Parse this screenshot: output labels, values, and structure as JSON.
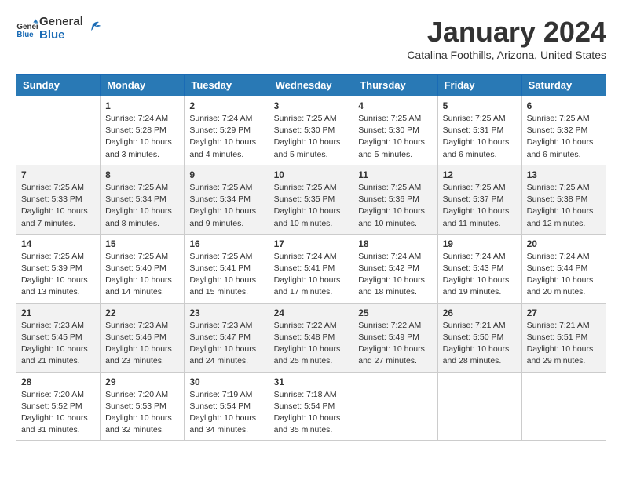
{
  "header": {
    "logo_line1": "General",
    "logo_line2": "Blue",
    "month_title": "January 2024",
    "location": "Catalina Foothills, Arizona, United States"
  },
  "days_of_week": [
    "Sunday",
    "Monday",
    "Tuesday",
    "Wednesday",
    "Thursday",
    "Friday",
    "Saturday"
  ],
  "weeks": [
    [
      {
        "day": "",
        "info": ""
      },
      {
        "day": "1",
        "info": "Sunrise: 7:24 AM\nSunset: 5:28 PM\nDaylight: 10 hours\nand 3 minutes."
      },
      {
        "day": "2",
        "info": "Sunrise: 7:24 AM\nSunset: 5:29 PM\nDaylight: 10 hours\nand 4 minutes."
      },
      {
        "day": "3",
        "info": "Sunrise: 7:25 AM\nSunset: 5:30 PM\nDaylight: 10 hours\nand 5 minutes."
      },
      {
        "day": "4",
        "info": "Sunrise: 7:25 AM\nSunset: 5:30 PM\nDaylight: 10 hours\nand 5 minutes."
      },
      {
        "day": "5",
        "info": "Sunrise: 7:25 AM\nSunset: 5:31 PM\nDaylight: 10 hours\nand 6 minutes."
      },
      {
        "day": "6",
        "info": "Sunrise: 7:25 AM\nSunset: 5:32 PM\nDaylight: 10 hours\nand 6 minutes."
      }
    ],
    [
      {
        "day": "7",
        "info": "Sunrise: 7:25 AM\nSunset: 5:33 PM\nDaylight: 10 hours\nand 7 minutes."
      },
      {
        "day": "8",
        "info": "Sunrise: 7:25 AM\nSunset: 5:34 PM\nDaylight: 10 hours\nand 8 minutes."
      },
      {
        "day": "9",
        "info": "Sunrise: 7:25 AM\nSunset: 5:34 PM\nDaylight: 10 hours\nand 9 minutes."
      },
      {
        "day": "10",
        "info": "Sunrise: 7:25 AM\nSunset: 5:35 PM\nDaylight: 10 hours\nand 10 minutes."
      },
      {
        "day": "11",
        "info": "Sunrise: 7:25 AM\nSunset: 5:36 PM\nDaylight: 10 hours\nand 10 minutes."
      },
      {
        "day": "12",
        "info": "Sunrise: 7:25 AM\nSunset: 5:37 PM\nDaylight: 10 hours\nand 11 minutes."
      },
      {
        "day": "13",
        "info": "Sunrise: 7:25 AM\nSunset: 5:38 PM\nDaylight: 10 hours\nand 12 minutes."
      }
    ],
    [
      {
        "day": "14",
        "info": "Sunrise: 7:25 AM\nSunset: 5:39 PM\nDaylight: 10 hours\nand 13 minutes."
      },
      {
        "day": "15",
        "info": "Sunrise: 7:25 AM\nSunset: 5:40 PM\nDaylight: 10 hours\nand 14 minutes."
      },
      {
        "day": "16",
        "info": "Sunrise: 7:25 AM\nSunset: 5:41 PM\nDaylight: 10 hours\nand 15 minutes."
      },
      {
        "day": "17",
        "info": "Sunrise: 7:24 AM\nSunset: 5:41 PM\nDaylight: 10 hours\nand 17 minutes."
      },
      {
        "day": "18",
        "info": "Sunrise: 7:24 AM\nSunset: 5:42 PM\nDaylight: 10 hours\nand 18 minutes."
      },
      {
        "day": "19",
        "info": "Sunrise: 7:24 AM\nSunset: 5:43 PM\nDaylight: 10 hours\nand 19 minutes."
      },
      {
        "day": "20",
        "info": "Sunrise: 7:24 AM\nSunset: 5:44 PM\nDaylight: 10 hours\nand 20 minutes."
      }
    ],
    [
      {
        "day": "21",
        "info": "Sunrise: 7:23 AM\nSunset: 5:45 PM\nDaylight: 10 hours\nand 21 minutes."
      },
      {
        "day": "22",
        "info": "Sunrise: 7:23 AM\nSunset: 5:46 PM\nDaylight: 10 hours\nand 23 minutes."
      },
      {
        "day": "23",
        "info": "Sunrise: 7:23 AM\nSunset: 5:47 PM\nDaylight: 10 hours\nand 24 minutes."
      },
      {
        "day": "24",
        "info": "Sunrise: 7:22 AM\nSunset: 5:48 PM\nDaylight: 10 hours\nand 25 minutes."
      },
      {
        "day": "25",
        "info": "Sunrise: 7:22 AM\nSunset: 5:49 PM\nDaylight: 10 hours\nand 27 minutes."
      },
      {
        "day": "26",
        "info": "Sunrise: 7:21 AM\nSunset: 5:50 PM\nDaylight: 10 hours\nand 28 minutes."
      },
      {
        "day": "27",
        "info": "Sunrise: 7:21 AM\nSunset: 5:51 PM\nDaylight: 10 hours\nand 29 minutes."
      }
    ],
    [
      {
        "day": "28",
        "info": "Sunrise: 7:20 AM\nSunset: 5:52 PM\nDaylight: 10 hours\nand 31 minutes."
      },
      {
        "day": "29",
        "info": "Sunrise: 7:20 AM\nSunset: 5:53 PM\nDaylight: 10 hours\nand 32 minutes."
      },
      {
        "day": "30",
        "info": "Sunrise: 7:19 AM\nSunset: 5:54 PM\nDaylight: 10 hours\nand 34 minutes."
      },
      {
        "day": "31",
        "info": "Sunrise: 7:18 AM\nSunset: 5:54 PM\nDaylight: 10 hours\nand 35 minutes."
      },
      {
        "day": "",
        "info": ""
      },
      {
        "day": "",
        "info": ""
      },
      {
        "day": "",
        "info": ""
      }
    ]
  ]
}
